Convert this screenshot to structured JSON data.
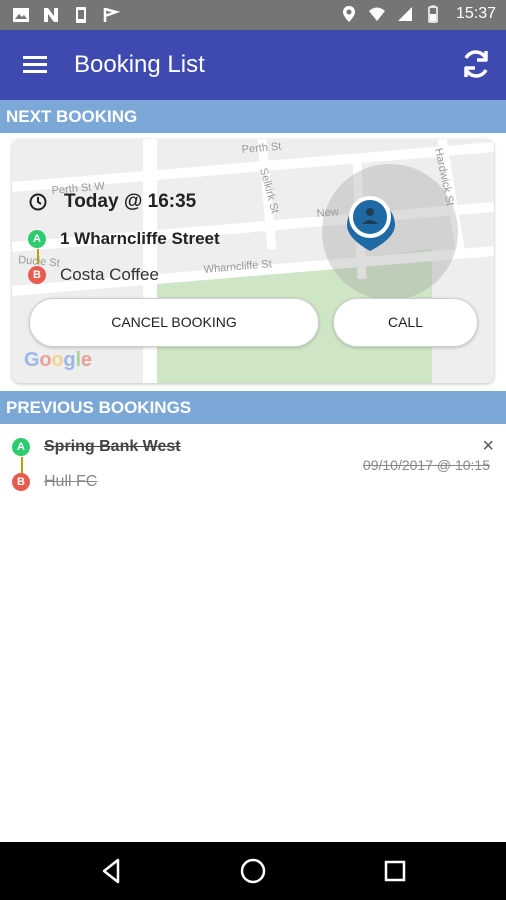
{
  "status_bar": {
    "time": "15:37",
    "left_icons": [
      "image-icon",
      "n-icon",
      "battery-saver-icon",
      "flag-icon"
    ],
    "right_icons": [
      "location-icon",
      "wifi-icon",
      "signal-icon",
      "battery-icon"
    ]
  },
  "app_bar": {
    "title": "Booking List"
  },
  "sections": {
    "next_booking": "NEXT BOOKING",
    "previous_bookings": "PREVIOUS BOOKINGS"
  },
  "next_booking": {
    "time": "Today @ 16:35",
    "pickup": "1 Wharncliffe Street",
    "dropoff": "Costa Coffee",
    "badge_a": "A",
    "badge_b": "B",
    "cancel_label": "CANCEL BOOKING",
    "call_label": "CALL",
    "map_labels": {
      "perth_st": "Perth St",
      "perth_st_w": "Perth St W",
      "selkirk_st": "Selkirk St",
      "hardwick_st": "Hardwick St",
      "new": "New",
      "wharncliffe_st": "Wharncliffe St",
      "ducie": "Ducie St",
      "google": "Google"
    }
  },
  "previous_bookings": [
    {
      "pickup": "Spring Bank West",
      "dropoff": "Hull FC",
      "datetime": "09/10/2017 @ 10:15",
      "badge_a": "A",
      "badge_b": "B",
      "close": "×"
    }
  ],
  "colors": {
    "app_bar": "#3f4ab1",
    "section_header": "#7ba8d6",
    "badge_a": "#2ecc71",
    "badge_b": "#e85b4e",
    "pin": "#1f6aa5"
  }
}
